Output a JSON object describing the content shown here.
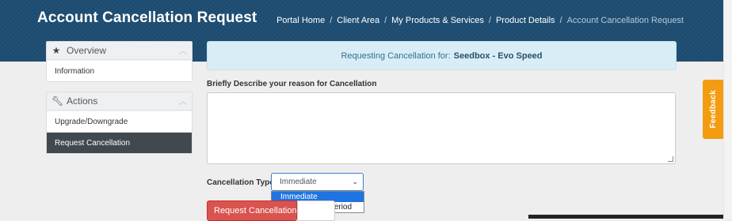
{
  "header": {
    "title": "Account Cancellation Request",
    "breadcrumb": [
      "Portal Home",
      "Client Area",
      "My Products & Services",
      "Product Details",
      "Account Cancellation Request"
    ],
    "separator": "/"
  },
  "sidebar": {
    "overview": {
      "title": "Overview",
      "icon": "star-icon",
      "items": [
        "Information"
      ]
    },
    "actions": {
      "title": "Actions",
      "icon": "wrench-icon",
      "items": [
        "Upgrade/Downgrade",
        "Request Cancellation"
      ],
      "active_index": 1
    }
  },
  "notice": {
    "prefix": "Requesting Cancellation for:",
    "product": "Seedbox - Evo Speed"
  },
  "form": {
    "reason_label": "Briefly Describe your reason for Cancellation",
    "reason_value": "",
    "type_label": "Cancellation Type",
    "type_selected": "Immediate",
    "type_options": [
      "Immediate",
      "End of Billing Period"
    ],
    "submit_label": "Request Cancellation"
  },
  "feedback_tab": "Feedback",
  "colors": {
    "header_bg": "#1e4d73",
    "notice_bg": "#d9edf7",
    "danger": "#d9534f",
    "feedback": "#f39c12",
    "active_nav": "#41494e"
  }
}
